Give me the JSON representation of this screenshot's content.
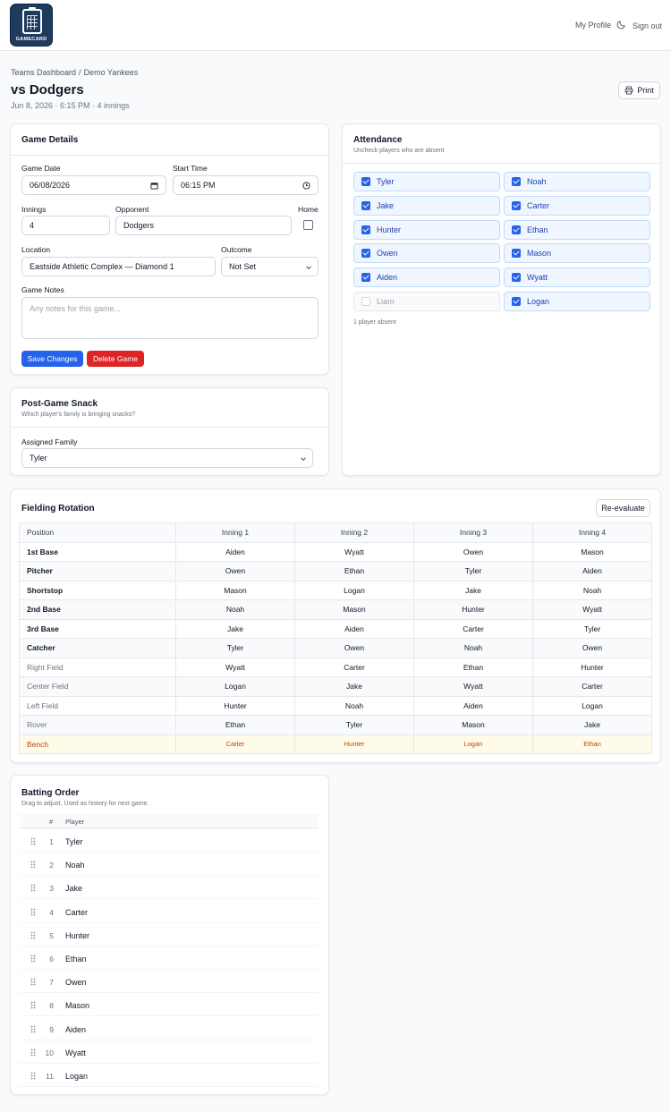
{
  "app": {
    "logo_text": "GAMECARD"
  },
  "nav": {
    "profile": "My Profile",
    "signout": "Sign out"
  },
  "breadcrumb": {
    "root": "Teams Dashboard",
    "sep": "/",
    "team": "Demo Yankees"
  },
  "page": {
    "title": "vs Dodgers",
    "subtitle": "Jun 8, 2026 · 6:15 PM · 4 innings",
    "print_label": "Print"
  },
  "game_details": {
    "title": "Game Details",
    "date_label": "Game Date",
    "date_value": "06/08/2026",
    "time_label": "Start Time",
    "time_value": "06:15  PM",
    "innings_label": "Innings",
    "innings_value": "4",
    "opponent_label": "Opponent",
    "opponent_value": "Dodgers",
    "home_label": "Home",
    "home_checked": false,
    "location_label": "Location",
    "location_value": "Eastside Athletic Complex — Diamond 1",
    "outcome_label": "Outcome",
    "outcome_value": "Not Set",
    "notes_label": "Game Notes",
    "notes_placeholder": "Any notes for this game...",
    "save_label": "Save Changes",
    "delete_label": "Delete Game"
  },
  "attendance": {
    "title": "Attendance",
    "subtitle": "Uncheck players who are absent",
    "players": [
      {
        "name": "Tyler",
        "present": true
      },
      {
        "name": "Noah",
        "present": true
      },
      {
        "name": "Jake",
        "present": true
      },
      {
        "name": "Carter",
        "present": true
      },
      {
        "name": "Hunter",
        "present": true
      },
      {
        "name": "Ethan",
        "present": true
      },
      {
        "name": "Owen",
        "present": true
      },
      {
        "name": "Mason",
        "present": true
      },
      {
        "name": "Aiden",
        "present": true
      },
      {
        "name": "Wyatt",
        "present": true
      },
      {
        "name": "Liam",
        "present": false
      },
      {
        "name": "Logan",
        "present": true
      }
    ],
    "summary": "1 player absent"
  },
  "snack": {
    "title": "Post-Game Snack",
    "subtitle": "Which player's family is bringing snacks?",
    "family_label": "Assigned Family",
    "family_value": "Tyler"
  },
  "rotation": {
    "title": "Fielding Rotation",
    "reevaluate_label": "Re-evaluate",
    "headers": [
      "Position",
      "Inning 1",
      "Inning 2",
      "Inning 3",
      "Inning 4"
    ],
    "rows": [
      {
        "position": "1st Base",
        "infield": true,
        "players": [
          "Aiden",
          "Wyatt",
          "Owen",
          "Mason"
        ]
      },
      {
        "position": "Pitcher",
        "infield": true,
        "players": [
          "Owen",
          "Ethan",
          "Tyler",
          "Aiden"
        ]
      },
      {
        "position": "Shortstop",
        "infield": true,
        "players": [
          "Mason",
          "Logan",
          "Jake",
          "Noah"
        ]
      },
      {
        "position": "2nd Base",
        "infield": true,
        "players": [
          "Noah",
          "Mason",
          "Hunter",
          "Wyatt"
        ]
      },
      {
        "position": "3rd Base",
        "infield": true,
        "players": [
          "Jake",
          "Aiden",
          "Carter",
          "Tyler"
        ]
      },
      {
        "position": "Catcher",
        "infield": true,
        "players": [
          "Tyler",
          "Owen",
          "Noah",
          "Owen"
        ]
      },
      {
        "position": "Right Field",
        "infield": false,
        "players": [
          "Wyatt",
          "Carter",
          "Ethan",
          "Hunter"
        ]
      },
      {
        "position": "Center Field",
        "infield": false,
        "players": [
          "Logan",
          "Jake",
          "Wyatt",
          "Carter"
        ]
      },
      {
        "position": "Left Field",
        "infield": false,
        "players": [
          "Hunter",
          "Noah",
          "Aiden",
          "Logan"
        ]
      },
      {
        "position": "Rover",
        "infield": false,
        "players": [
          "Ethan",
          "Tyler",
          "Mason",
          "Jake"
        ]
      }
    ],
    "bench": {
      "position": "Bench",
      "players": [
        "Carter",
        "Hunter",
        "Logan",
        "Ethan"
      ]
    }
  },
  "batting": {
    "title": "Batting Order",
    "subtitle": "Drag to adjust. Used as history for next game.",
    "col_num": "#",
    "col_player": "Player",
    "order": [
      "Tyler",
      "Noah",
      "Jake",
      "Carter",
      "Hunter",
      "Ethan",
      "Owen",
      "Mason",
      "Aiden",
      "Wyatt",
      "Logan"
    ]
  },
  "colors": {
    "accent": "#2563eb",
    "danger": "#dc2626",
    "bench": "#c2410c",
    "logo_bg": "#1e3a5f"
  }
}
